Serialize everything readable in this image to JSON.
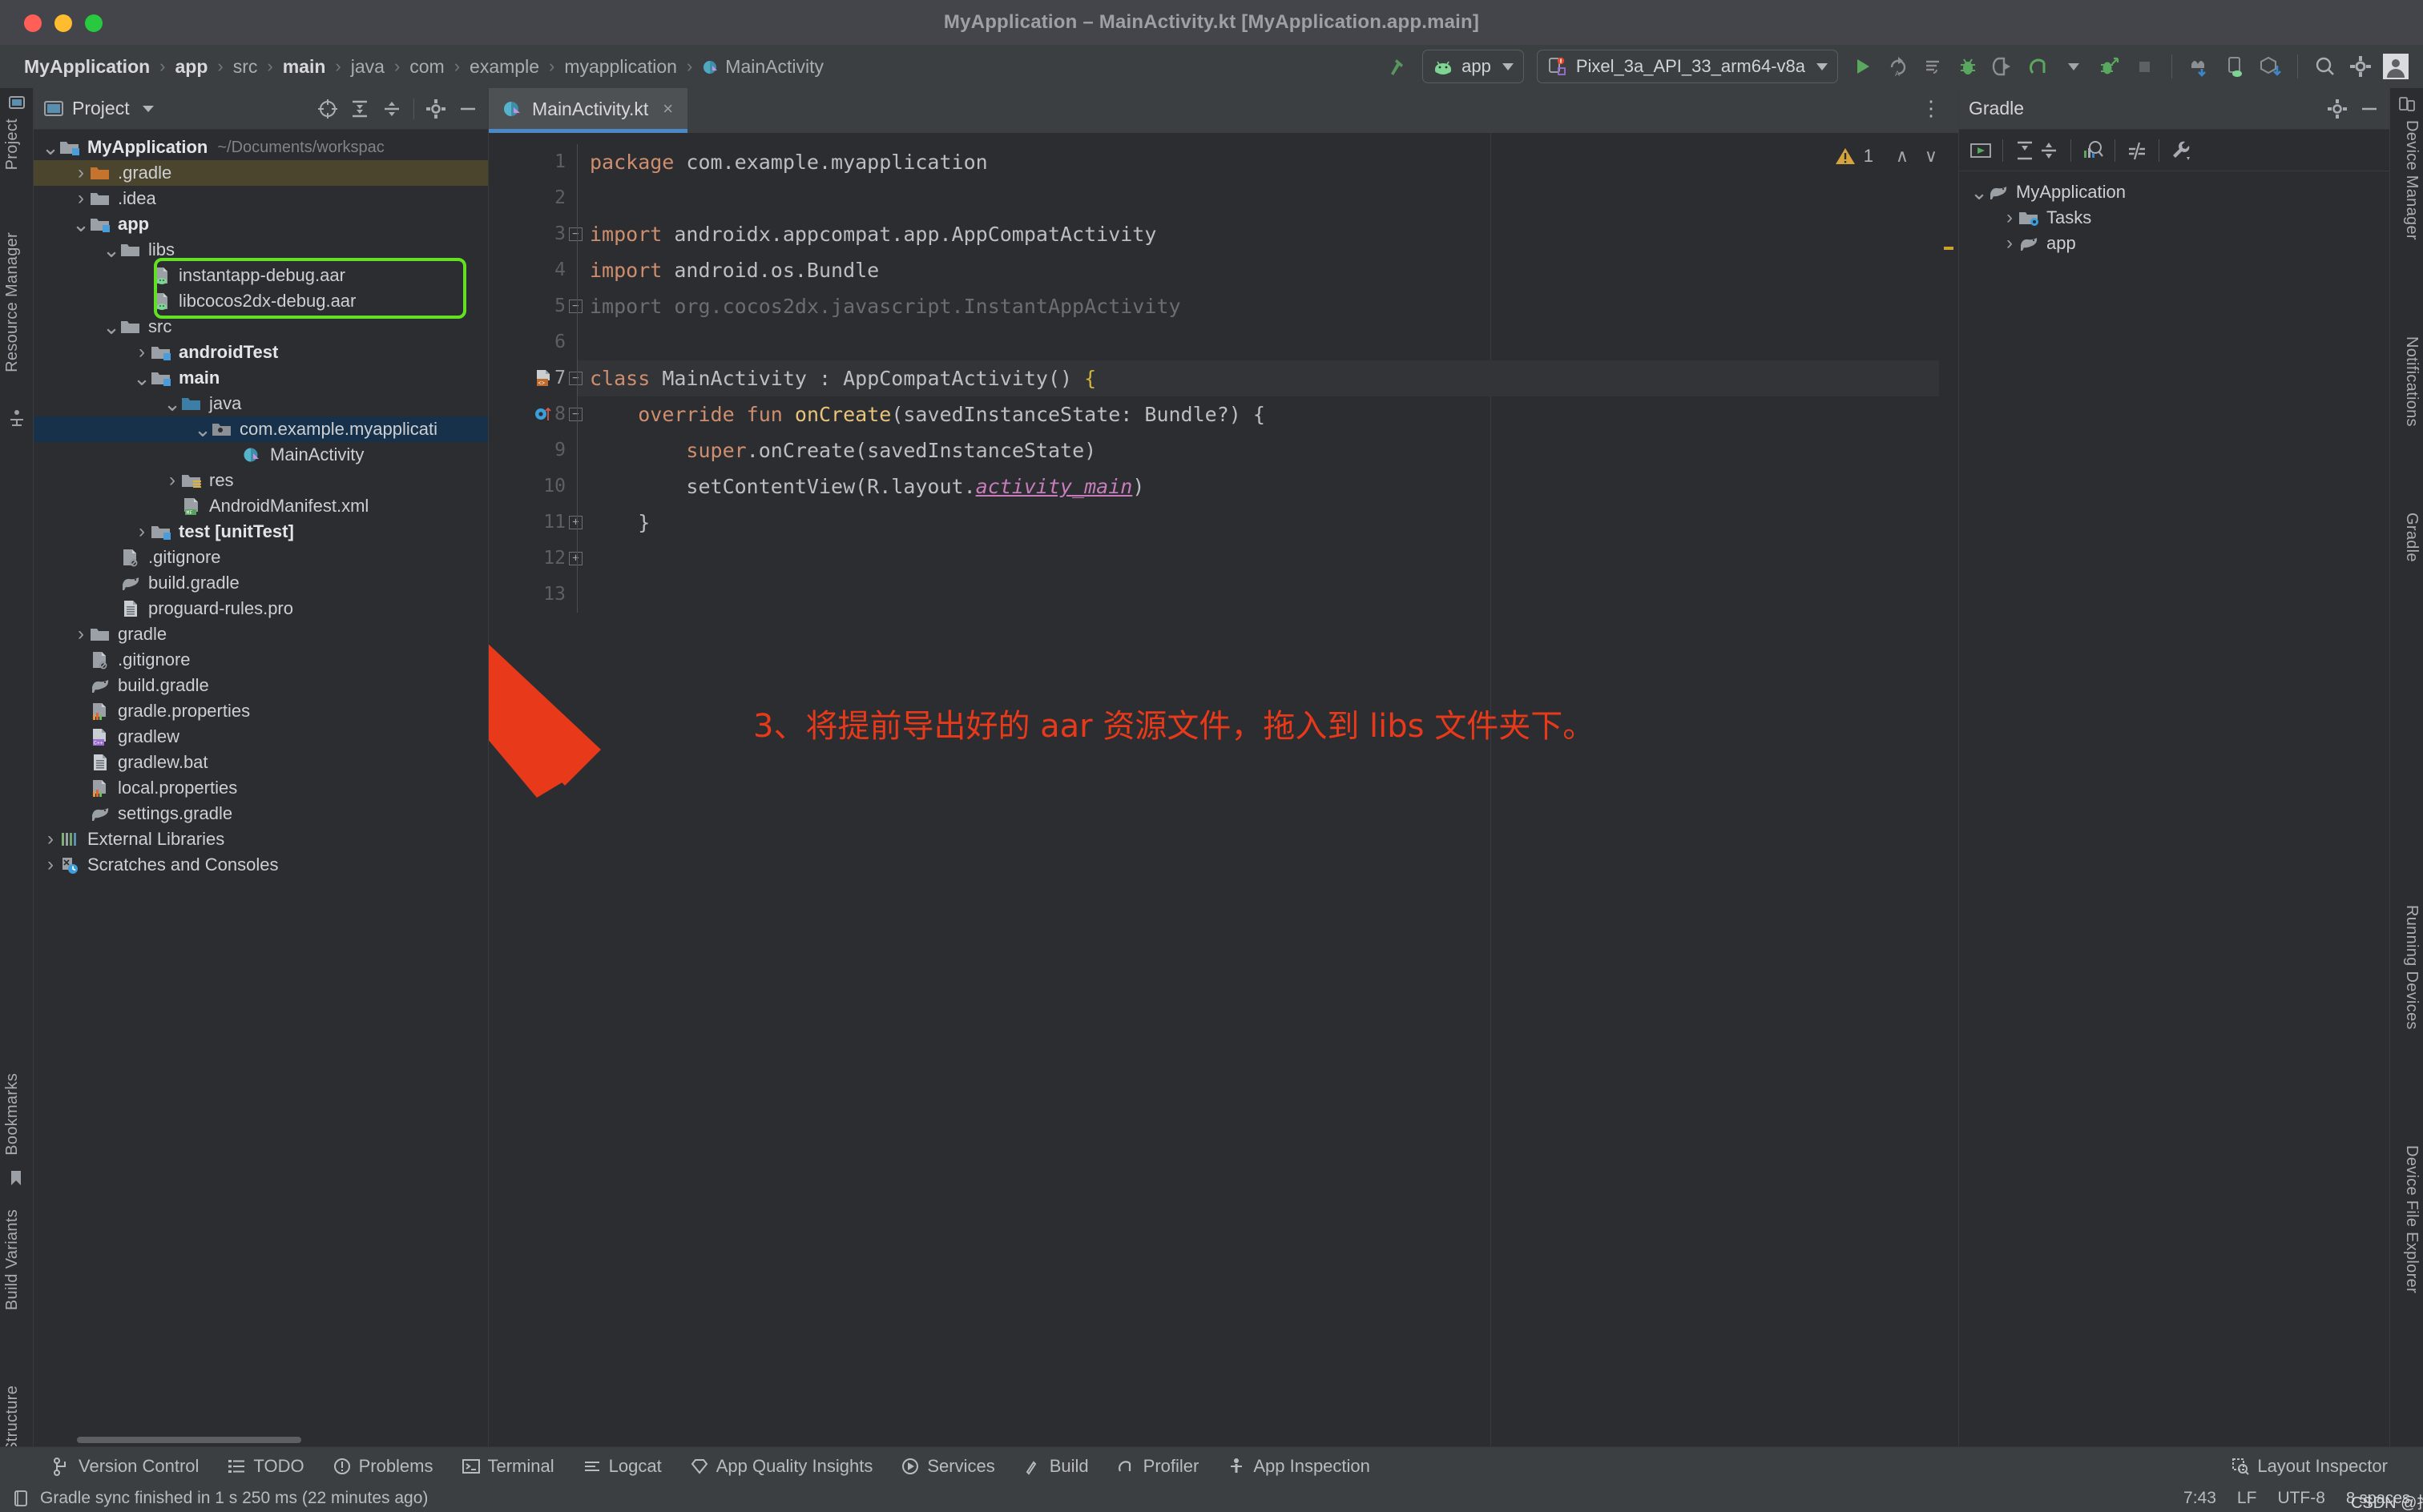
{
  "window": {
    "title": "MyApplication – MainActivity.kt [MyApplication.app.main]",
    "traffic_lights": [
      "close-button",
      "minimize-button",
      "zoom-button"
    ]
  },
  "breadcrumb": {
    "items": [
      {
        "label": "MyApplication",
        "bold": true,
        "icon": ""
      },
      {
        "label": "app",
        "bold": true,
        "icon": ""
      },
      {
        "label": "src",
        "bold": false,
        "icon": ""
      },
      {
        "label": "main",
        "bold": true,
        "icon": ""
      },
      {
        "label": "java",
        "bold": false,
        "icon": ""
      },
      {
        "label": "com",
        "bold": false,
        "icon": ""
      },
      {
        "label": "example",
        "bold": false,
        "icon": ""
      },
      {
        "label": "myapplication",
        "bold": false,
        "icon": ""
      },
      {
        "label": "MainActivity",
        "bold": false,
        "icon": "kotlin-class-icon"
      }
    ],
    "separator": "›"
  },
  "toolbar": {
    "build_icon": "hammer-icon",
    "run_config": {
      "label": "app",
      "icon": "android-head-icon",
      "caret": "▾"
    },
    "device": {
      "label": "Pixel_3a_API_33_arm64-v8a",
      "icon": "device-icon",
      "caret": "▾"
    },
    "actions": [
      "run-icon",
      "rerun-icon",
      "apply-changes-icon",
      "debug-icon",
      "attach-debugger-icon",
      "profile-icon",
      "profile-caret-icon",
      "run-with-coverage-icon",
      "stop-icon"
    ],
    "actions_group2": [
      "device-mirror-icon",
      "device-explorer-icon",
      "build-apk-icon"
    ],
    "actions_group3": [
      "search-icon",
      "settings-gear-icon",
      "account-avatar-icon"
    ]
  },
  "left_strip": {
    "tabs": [
      {
        "label": "Project",
        "name": "project"
      },
      {
        "label": "Resource Manager",
        "name": "resource-manager"
      },
      {
        "label": "Bookmarks",
        "name": "bookmarks"
      },
      {
        "label": "Build Variants",
        "name": "build-variants"
      },
      {
        "label": "Structure",
        "name": "structure"
      }
    ]
  },
  "right_strip": {
    "tabs": [
      {
        "label": "Device Manager",
        "name": "device-manager"
      },
      {
        "label": "Notifications",
        "name": "notifications"
      },
      {
        "label": "Gradle",
        "name": "gradle"
      },
      {
        "label": "Running Devices",
        "name": "running-devices"
      },
      {
        "label": "Device File Explorer",
        "name": "device-file-explorer"
      }
    ]
  },
  "project_panel": {
    "title": "Project",
    "header_icons": [
      "select-opened-file-icon",
      "expand-all-icon",
      "collapse-all-icon",
      "settings-gear-icon",
      "hide-icon"
    ],
    "tree": [
      {
        "depth": 0,
        "arrow": "down",
        "icon": "module-folder-icon",
        "label": "MyApplication",
        "bold": true,
        "sub": "~/Documents/workspac",
        "state": "none"
      },
      {
        "depth": 1,
        "arrow": "right",
        "icon": "excluded-folder-icon",
        "label": ".gradle",
        "bold": false,
        "sub": "",
        "state": "olive"
      },
      {
        "depth": 1,
        "arrow": "right",
        "icon": "folder-icon",
        "label": ".idea",
        "bold": false,
        "sub": "",
        "state": "none"
      },
      {
        "depth": 1,
        "arrow": "down",
        "icon": "module-folder-icon",
        "label": "app",
        "bold": true,
        "sub": "",
        "state": "none"
      },
      {
        "depth": 2,
        "arrow": "down",
        "icon": "folder-icon",
        "label": "libs",
        "bold": false,
        "sub": "",
        "state": "none"
      },
      {
        "depth": 3,
        "arrow": "none",
        "icon": "aar-file-icon",
        "label": "instantapp-debug.aar",
        "bold": false,
        "sub": "",
        "state": "none"
      },
      {
        "depth": 3,
        "arrow": "none",
        "icon": "aar-file-icon",
        "label": "libcocos2dx-debug.aar",
        "bold": false,
        "sub": "",
        "state": "none"
      },
      {
        "depth": 2,
        "arrow": "down",
        "icon": "folder-icon",
        "label": "src",
        "bold": false,
        "sub": "",
        "state": "none"
      },
      {
        "depth": 3,
        "arrow": "right",
        "icon": "module-folder-icon",
        "label": "androidTest",
        "bold": true,
        "sub": "",
        "state": "none"
      },
      {
        "depth": 3,
        "arrow": "down",
        "icon": "module-folder-icon",
        "label": "main",
        "bold": true,
        "sub": "",
        "state": "none"
      },
      {
        "depth": 4,
        "arrow": "down",
        "icon": "source-root-icon",
        "label": "java",
        "bold": false,
        "sub": "",
        "state": "none"
      },
      {
        "depth": 5,
        "arrow": "down",
        "icon": "package-icon",
        "label": "com.example.myapplicati",
        "bold": false,
        "sub": "",
        "state": "blue"
      },
      {
        "depth": 6,
        "arrow": "none",
        "icon": "kotlin-class-icon",
        "label": "MainActivity",
        "bold": false,
        "sub": "",
        "state": "none"
      },
      {
        "depth": 4,
        "arrow": "right",
        "icon": "res-folder-icon",
        "label": "res",
        "bold": false,
        "sub": "",
        "state": "none"
      },
      {
        "depth": 4,
        "arrow": "none",
        "icon": "manifest-file-icon",
        "label": "AndroidManifest.xml",
        "bold": false,
        "sub": "",
        "state": "none"
      },
      {
        "depth": 3,
        "arrow": "right",
        "icon": "test-module-icon",
        "label": "test [unitTest]",
        "bold": true,
        "sub": "",
        "state": "none"
      },
      {
        "depth": 2,
        "arrow": "none",
        "icon": "gitignore-file-icon",
        "label": ".gitignore",
        "bold": false,
        "sub": "",
        "state": "none"
      },
      {
        "depth": 2,
        "arrow": "none",
        "icon": "gradle-file-icon",
        "label": "build.gradle",
        "bold": false,
        "sub": "",
        "state": "none"
      },
      {
        "depth": 2,
        "arrow": "none",
        "icon": "text-file-icon",
        "label": "proguard-rules.pro",
        "bold": false,
        "sub": "",
        "state": "none"
      },
      {
        "depth": 1,
        "arrow": "right",
        "icon": "folder-icon",
        "label": "gradle",
        "bold": false,
        "sub": "",
        "state": "none"
      },
      {
        "depth": 1,
        "arrow": "none",
        "icon": "gitignore-file-icon",
        "label": ".gitignore",
        "bold": false,
        "sub": "",
        "state": "none"
      },
      {
        "depth": 1,
        "arrow": "none",
        "icon": "gradle-file-icon",
        "label": "build.gradle",
        "bold": false,
        "sub": "",
        "state": "none"
      },
      {
        "depth": 1,
        "arrow": "none",
        "icon": "properties-file-icon",
        "label": "gradle.properties",
        "bold": false,
        "sub": "",
        "state": "none"
      },
      {
        "depth": 1,
        "arrow": "none",
        "icon": "shell-file-icon",
        "label": "gradlew",
        "bold": false,
        "sub": "",
        "state": "none"
      },
      {
        "depth": 1,
        "arrow": "none",
        "icon": "text-file-icon",
        "label": "gradlew.bat",
        "bold": false,
        "sub": "",
        "state": "none"
      },
      {
        "depth": 1,
        "arrow": "none",
        "icon": "properties-file-icon",
        "label": "local.properties",
        "bold": false,
        "sub": "",
        "state": "none"
      },
      {
        "depth": 1,
        "arrow": "none",
        "icon": "gradle-file-icon",
        "label": "settings.gradle",
        "bold": false,
        "sub": "",
        "state": "none"
      },
      {
        "depth": 0,
        "arrow": "right",
        "icon": "external-libraries-icon",
        "label": "External Libraries",
        "bold": false,
        "sub": "",
        "state": "none"
      },
      {
        "depth": 0,
        "arrow": "right",
        "icon": "scratches-icon",
        "label": "Scratches and Consoles",
        "bold": false,
        "sub": "",
        "state": "none"
      }
    ],
    "highlight_note": "green-box-around-aar-files"
  },
  "editor": {
    "tab": {
      "label": "MainActivity.kt",
      "icon": "kotlin-class-icon",
      "close": "×"
    },
    "warning_count": "1",
    "warning_icon": "warning-triangle-icon",
    "nav_up_icon": "∧",
    "nav_down_icon": "∨",
    "more_icon": "⋮",
    "lines": [
      {
        "n": "1",
        "segments": [
          {
            "t": "package",
            "c": "kw"
          },
          {
            "t": " com.example.myapplication",
            "c": "pln"
          }
        ],
        "fold": "",
        "gutter_icon": "",
        "current": false
      },
      {
        "n": "2",
        "segments": [],
        "fold": "",
        "gutter_icon": "",
        "current": false
      },
      {
        "n": "3",
        "segments": [
          {
            "t": "import",
            "c": "kw"
          },
          {
            "t": " androidx.appcompat.app.AppCompatActivity",
            "c": "pln"
          }
        ],
        "fold": "minus",
        "gutter_icon": "",
        "current": false
      },
      {
        "n": "4",
        "segments": [
          {
            "t": "import",
            "c": "kw"
          },
          {
            "t": " android.os.Bundle",
            "c": "pln"
          }
        ],
        "fold": "",
        "gutter_icon": "",
        "current": false
      },
      {
        "n": "5",
        "segments": [
          {
            "t": "import org.cocos2dx.javascript.InstantAppActivity",
            "c": "dim"
          }
        ],
        "fold": "minus",
        "gutter_icon": "",
        "current": false
      },
      {
        "n": "6",
        "segments": [],
        "fold": "",
        "gutter_icon": "",
        "current": false
      },
      {
        "n": "7",
        "segments": [
          {
            "t": "class",
            "c": "kw"
          },
          {
            "t": " MainActivity : AppCompatActivity() ",
            "c": "pln"
          },
          {
            "t": "{",
            "c": "brace-y"
          }
        ],
        "fold": "minus",
        "gutter_icon": "kotlin-class-gutter-icon",
        "current": true
      },
      {
        "n": "8",
        "segments": [
          {
            "t": "    ",
            "c": "pln"
          },
          {
            "t": "override fun",
            "c": "kw"
          },
          {
            "t": " ",
            "c": "pln"
          },
          {
            "t": "onCreate",
            "c": "fn"
          },
          {
            "t": "(savedInstanceState: Bundle?) {",
            "c": "pln"
          }
        ],
        "fold": "minus",
        "gutter_icon": "override-method-icon",
        "current": false
      },
      {
        "n": "9",
        "segments": [
          {
            "t": "        ",
            "c": "pln"
          },
          {
            "t": "super",
            "c": "kw"
          },
          {
            "t": ".onCreate(savedInstanceState)",
            "c": "pln"
          }
        ],
        "fold": "",
        "gutter_icon": "",
        "current": false
      },
      {
        "n": "10",
        "segments": [
          {
            "t": "        setContentView(R.layout.",
            "c": "pln"
          },
          {
            "t": "activity_main",
            "c": "res-link"
          },
          {
            "t": ")",
            "c": "pln"
          }
        ],
        "fold": "",
        "gutter_icon": "",
        "current": false
      },
      {
        "n": "11",
        "segments": [
          {
            "t": "    }",
            "c": "pln"
          }
        ],
        "fold": "plus",
        "gutter_icon": "",
        "current": false
      },
      {
        "n": "12",
        "segments": [],
        "fold": "plus",
        "gutter_icon": "",
        "current": false
      },
      {
        "n": "13",
        "segments": [],
        "fold": "",
        "gutter_icon": "",
        "current": false
      }
    ]
  },
  "annotation": {
    "text": "3、将提前导出好的 aar 资源文件，拖入到 libs 文件夹下。",
    "color": "#e8391a",
    "arrow": "red-arrow-pointing-to-libs-folder"
  },
  "gradle_panel": {
    "title": "Gradle",
    "header_icons": [
      "settings-gear-icon",
      "hide-icon"
    ],
    "toolbar_icons": [
      "execute-gradle-task-icon",
      "expand-all-icon",
      "collapse-all-icon",
      "gradle-profiler-icon",
      "toggle-offline-icon",
      "gradle-settings-wrench-icon"
    ],
    "tree": [
      {
        "depth": 0,
        "arrow": "down",
        "icon": "gradle-elephant-icon",
        "label": "MyApplication"
      },
      {
        "depth": 1,
        "arrow": "right",
        "icon": "tasks-folder-icon",
        "label": "Tasks"
      },
      {
        "depth": 1,
        "arrow": "right",
        "icon": "gradle-elephant-icon",
        "label": "app"
      }
    ]
  },
  "bottom_bar": {
    "items": [
      {
        "label": "Version Control",
        "icon": "branch-icon"
      },
      {
        "label": "TODO",
        "icon": "todo-list-icon"
      },
      {
        "label": "Problems",
        "icon": "problems-icon"
      },
      {
        "label": "Terminal",
        "icon": "terminal-icon"
      },
      {
        "label": "Logcat",
        "icon": "logcat-icon"
      },
      {
        "label": "App Quality Insights",
        "icon": "diamond-icon"
      },
      {
        "label": "Services",
        "icon": "services-icon"
      },
      {
        "label": "Build",
        "icon": "build-hammer-icon"
      },
      {
        "label": "Profiler",
        "icon": "profiler-icon"
      },
      {
        "label": "App Inspection",
        "icon": "app-inspection-icon"
      }
    ],
    "right_item": {
      "label": "Layout Inspector",
      "icon": "layout-inspector-icon"
    }
  },
  "status_bar": {
    "message_icon": "event-log-icon",
    "message": "Gradle sync finished in 1 s 250 ms (22 minutes ago)",
    "caret_position": "7:43",
    "line_separator": "LF",
    "encoding": "UTF-8",
    "indent": "8 spaces",
    "watermark_overlay": "CSDN @抱女友就犯困"
  },
  "colors": {
    "accent_blue": "#4a88c7",
    "highlight_green": "#62e024",
    "annotation_red": "#e8391a",
    "selection_blue": "#17314a",
    "selection_olive": "#4c452e",
    "panel_bg": "#2b2d30",
    "chrome_bg": "#3c3f41",
    "titlebar_bg": "#43454a",
    "keyword_orange": "#cf8e6d",
    "function_yellow": "#e8c37a"
  }
}
